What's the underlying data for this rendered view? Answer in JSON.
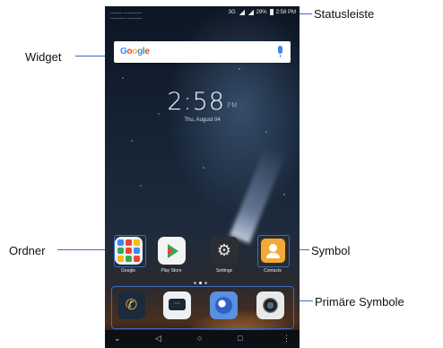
{
  "callouts": {
    "statusbar": "Statusleiste",
    "widget": "Widget",
    "folder": "Ordner",
    "symbol": "Symbol",
    "primary": "Primäre Symbole"
  },
  "status": {
    "carrier": "____ ______\n_____ _____",
    "network": "3G",
    "battery": "29%",
    "time": "2:58 PM"
  },
  "search": {
    "logo": "Google",
    "mic_icon": "microphone-icon"
  },
  "clock": {
    "time": "2:58",
    "ampm": "PM",
    "date": "Thu, August 04"
  },
  "apps": [
    {
      "label": "Google",
      "icon": "google-folder-icon"
    },
    {
      "label": "Play Store",
      "icon": "play-store-icon"
    },
    {
      "label": "Settings",
      "icon": "settings-gear-icon"
    },
    {
      "label": "Contacts",
      "icon": "contacts-icon"
    }
  ],
  "dock": [
    {
      "icon": "phone-icon"
    },
    {
      "icon": "messages-icon"
    },
    {
      "icon": "browser-icon"
    },
    {
      "icon": "camera-icon"
    }
  ],
  "navbar": {
    "down": "⌄",
    "back": "◁",
    "home": "○",
    "recents": "□",
    "menu": "⋮"
  },
  "colors": {
    "callout_line": "#3b6cc2",
    "google_blue": "#4285f4",
    "google_red": "#ea4335",
    "google_yellow": "#fbbc05",
    "google_green": "#34a853"
  }
}
